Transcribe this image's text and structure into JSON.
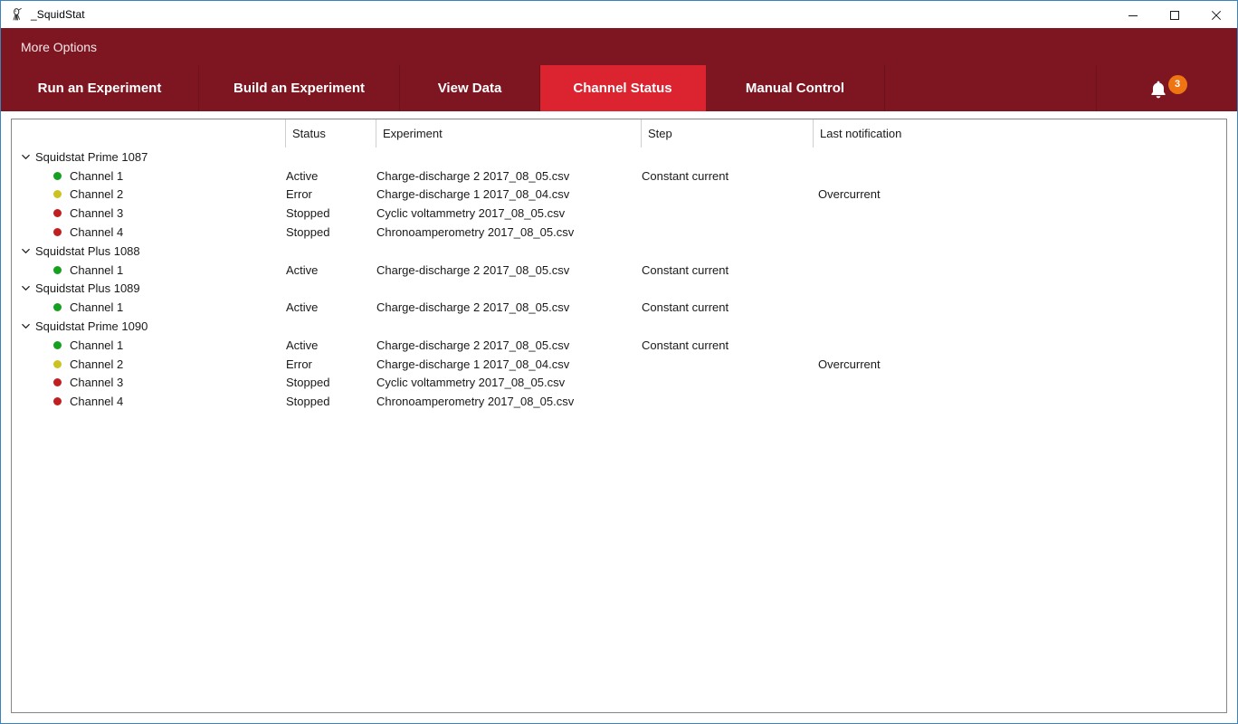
{
  "window": {
    "title": "_SquidStat",
    "icon": "squid-icon",
    "controls": [
      {
        "name": "minimize",
        "glyph": "minimize-icon"
      },
      {
        "name": "maximize",
        "glyph": "maximize-icon"
      },
      {
        "name": "close",
        "glyph": "close-icon"
      }
    ]
  },
  "menubar": {
    "more_options_label": "More Options"
  },
  "tabs": [
    {
      "label": "Run an Experiment",
      "active": false
    },
    {
      "label": "Build an Experiment",
      "active": false
    },
    {
      "label": "View Data",
      "active": false
    },
    {
      "label": "Channel Status",
      "active": true
    },
    {
      "label": "Manual Control",
      "active": false
    }
  ],
  "notifications": {
    "icon": "bell-icon",
    "count": "3",
    "badge_color": "#ef7512"
  },
  "colors": {
    "brand_dark_red": "#7d1621",
    "brand_bright_red": "#dc2430",
    "status_active": "#16a020",
    "status_error": "#ccc220",
    "status_stopped": "#c02020",
    "window_border": "#3a84bd"
  },
  "table": {
    "columns": [
      "",
      "Status",
      "Experiment",
      "Step",
      "Last notification"
    ],
    "groups": [
      {
        "device": "Squidstat Prime 1087",
        "expanded": true,
        "channels": [
          {
            "name": "Channel 1",
            "dot": "status_active",
            "status": "Active",
            "experiment": "Charge-discharge 2 2017_08_05.csv",
            "step": "Constant current",
            "last_notification": ""
          },
          {
            "name": "Channel 2",
            "dot": "status_error",
            "status": "Error",
            "experiment": "Charge-discharge 1 2017_08_04.csv",
            "step": "",
            "last_notification": "Overcurrent"
          },
          {
            "name": "Channel 3",
            "dot": "status_stopped",
            "status": "Stopped",
            "experiment": "Cyclic voltammetry 2017_08_05.csv",
            "step": "",
            "last_notification": ""
          },
          {
            "name": "Channel 4",
            "dot": "status_stopped",
            "status": "Stopped",
            "experiment": "Chronoamperometry 2017_08_05.csv",
            "step": "",
            "last_notification": ""
          }
        ]
      },
      {
        "device": "Squidstat Plus 1088",
        "expanded": true,
        "channels": [
          {
            "name": "Channel 1",
            "dot": "status_active",
            "status": "Active",
            "experiment": "Charge-discharge 2 2017_08_05.csv",
            "step": "Constant current",
            "last_notification": ""
          }
        ]
      },
      {
        "device": "Squidstat Plus 1089",
        "expanded": true,
        "channels": [
          {
            "name": "Channel 1",
            "dot": "status_active",
            "status": "Active",
            "experiment": "Charge-discharge 2 2017_08_05.csv",
            "step": "Constant current",
            "last_notification": ""
          }
        ]
      },
      {
        "device": "Squidstat Prime 1090",
        "expanded": true,
        "channels": [
          {
            "name": "Channel 1",
            "dot": "status_active",
            "status": "Active",
            "experiment": "Charge-discharge 2 2017_08_05.csv",
            "step": "Constant current",
            "last_notification": ""
          },
          {
            "name": "Channel 2",
            "dot": "status_error",
            "status": "Error",
            "experiment": "Charge-discharge 1 2017_08_04.csv",
            "step": "",
            "last_notification": "Overcurrent"
          },
          {
            "name": "Channel 3",
            "dot": "status_stopped",
            "status": "Stopped",
            "experiment": "Cyclic voltammetry 2017_08_05.csv",
            "step": "",
            "last_notification": ""
          },
          {
            "name": "Channel 4",
            "dot": "status_stopped",
            "status": "Stopped",
            "experiment": "Chronoamperometry 2017_08_05.csv",
            "step": "",
            "last_notification": ""
          }
        ]
      }
    ]
  }
}
